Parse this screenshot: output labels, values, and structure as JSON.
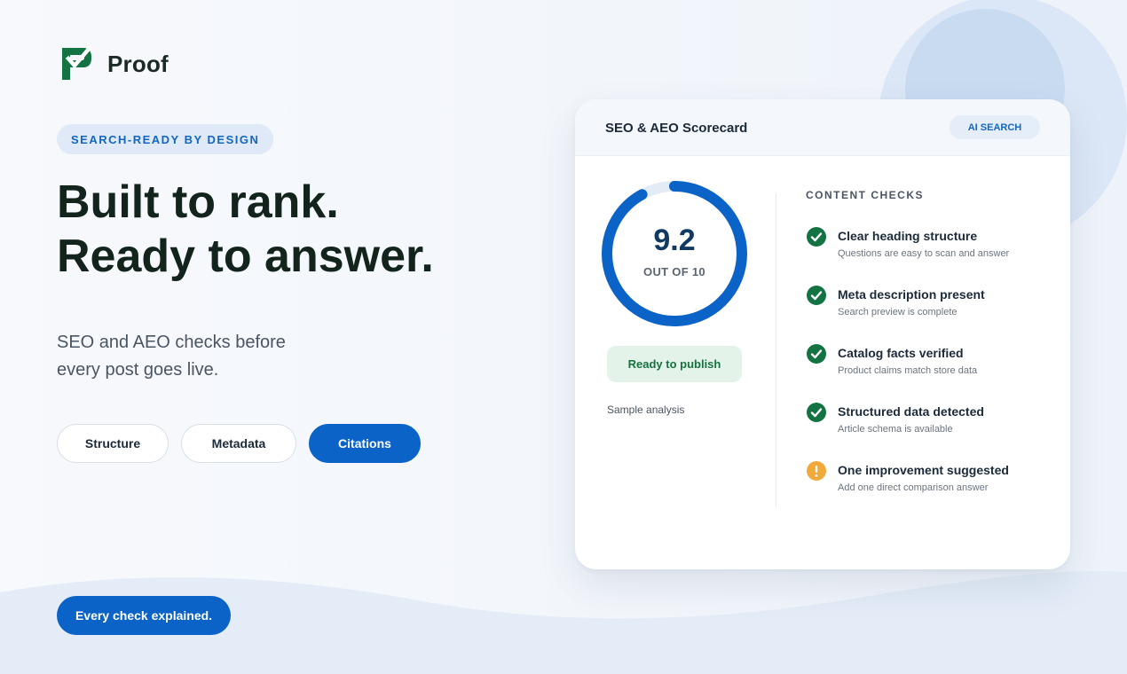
{
  "brand": {
    "name": "Proof",
    "logo_icon": "proof-check-icon",
    "logo_color": "#137342"
  },
  "hero": {
    "tag": "SEARCH-READY BY DESIGN",
    "headline_line1": "Built to rank.",
    "headline_line2": "Ready to answer.",
    "subtext_line1": "SEO and AEO checks before",
    "subtext_line2": "every post goes live."
  },
  "tabs": [
    {
      "label": "Structure",
      "active": false
    },
    {
      "label": "Metadata",
      "active": false
    },
    {
      "label": "Citations",
      "active": true
    }
  ],
  "cta_label": "Every check explained.",
  "scorecard": {
    "title": "SEO & AEO Scorecard",
    "badge": "AI SEARCH",
    "score": "9.2",
    "score_value": 9.2,
    "score_max": 10,
    "score_caption": "OUT OF 10",
    "status": "Ready to publish",
    "footnote": "Sample analysis",
    "checks_title": "CONTENT CHECKS",
    "checks": [
      {
        "label": "Clear heading structure",
        "description": "Questions are easy to scan and answer",
        "status": "pass",
        "icon": "check-circle-icon"
      },
      {
        "label": "Meta description present",
        "description": "Search preview is complete",
        "status": "pass",
        "icon": "check-circle-icon"
      },
      {
        "label": "Catalog facts verified",
        "description": "Product claims match store data",
        "status": "pass",
        "icon": "check-circle-icon"
      },
      {
        "label": "Structured data detected",
        "description": "Article schema is available",
        "status": "pass",
        "icon": "check-circle-icon"
      },
      {
        "label": "One improvement suggested",
        "description": "Add one direct comparison answer",
        "status": "warning",
        "icon": "warning-circle-icon"
      }
    ]
  },
  "colors": {
    "accent": "#0b63c7",
    "pass": "#137342",
    "warning": "#f2a93b",
    "gauge_track": "#e3ebf5"
  }
}
